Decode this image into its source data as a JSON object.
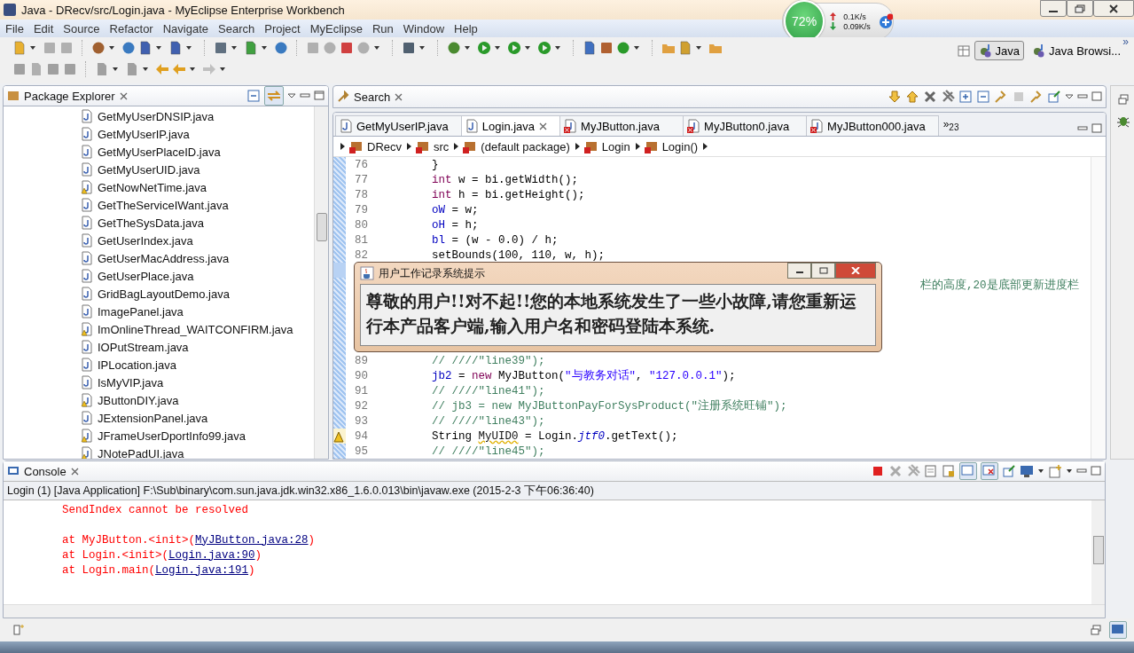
{
  "window": {
    "title": "Java - DRecv/src/Login.java - MyEclipse Enterprise Workbench"
  },
  "menu": [
    "File",
    "Edit",
    "Source",
    "Refactor",
    "Navigate",
    "Search",
    "Project",
    "MyEclipse",
    "Run",
    "Window",
    "Help"
  ],
  "network_widget": {
    "percent": "72%",
    "upload": "0.1K/s",
    "download": "0.09K/s"
  },
  "perspectives": [
    {
      "label": "Java",
      "selected": true
    },
    {
      "label": "Java Browsi...",
      "selected": false
    }
  ],
  "perspective_overflow": "»",
  "package_explorer": {
    "title": "Package Explorer",
    "items": [
      {
        "label": "GetMyUserDNSIP.java",
        "warning": false
      },
      {
        "label": "GetMyUserIP.java",
        "warning": false
      },
      {
        "label": "GetMyUserPlaceID.java",
        "warning": false
      },
      {
        "label": "GetMyUserUID.java",
        "warning": false
      },
      {
        "label": "GetNowNetTime.java",
        "warning": true
      },
      {
        "label": "GetTheServiceIWant.java",
        "warning": false
      },
      {
        "label": "GetTheSysData.java",
        "warning": false
      },
      {
        "label": "GetUserIndex.java",
        "warning": false
      },
      {
        "label": "GetUserMacAddress.java",
        "warning": false
      },
      {
        "label": "GetUserPlace.java",
        "warning": false
      },
      {
        "label": "GridBagLayoutDemo.java",
        "warning": false
      },
      {
        "label": "ImagePanel.java",
        "warning": false
      },
      {
        "label": "ImOnlineThread_WAITCONFIRM.java",
        "warning": true
      },
      {
        "label": "IOPutStream.java",
        "warning": false
      },
      {
        "label": "IPLocation.java",
        "warning": false
      },
      {
        "label": "IsMyVIP.java",
        "warning": false
      },
      {
        "label": "JButtonDIY.java",
        "warning": true
      },
      {
        "label": "JExtensionPanel.java",
        "warning": false
      },
      {
        "label": "JFrameUserDportInfo99.java",
        "warning": true
      },
      {
        "label": "JNotePadUI.java",
        "warning": true
      }
    ]
  },
  "search_view": {
    "title": "Search"
  },
  "editor": {
    "tabs": [
      {
        "label": "GetMyUserIP.java",
        "selected": false,
        "error": false
      },
      {
        "label": "Login.java",
        "selected": true,
        "error": false
      },
      {
        "label": "MyJButton.java",
        "selected": false,
        "error": true
      },
      {
        "label": "MyJButton0.java",
        "selected": false,
        "error": true
      },
      {
        "label": "MyJButton000.java",
        "selected": false,
        "error": true
      }
    ],
    "overflow": "»$_{23}$",
    "breadcrumb": [
      "DRecv",
      "src",
      "(default package)",
      "Login",
      "Login()"
    ],
    "lines": [
      {
        "number": "76",
        "covered": false,
        "marker": false,
        "segments": [
          {
            "t": "}",
            "kind": "plain"
          }
        ]
      },
      {
        "number": "77",
        "covered": false,
        "marker": false,
        "segments": [
          {
            "t": "int",
            "kind": "keyword"
          },
          {
            "t": " w = bi.getWidth();",
            "kind": "plain"
          }
        ]
      },
      {
        "number": "78",
        "covered": false,
        "marker": false,
        "segments": [
          {
            "t": "int",
            "kind": "keyword"
          },
          {
            "t": " h = bi.getHeight();",
            "kind": "plain"
          }
        ]
      },
      {
        "number": "79",
        "covered": false,
        "marker": false,
        "segments": [
          {
            "t": "oW",
            "kind": "field"
          },
          {
            "t": " = w;",
            "kind": "plain"
          }
        ]
      },
      {
        "number": "80",
        "covered": false,
        "marker": false,
        "segments": [
          {
            "t": "oH",
            "kind": "field"
          },
          {
            "t": " = h;",
            "kind": "plain"
          }
        ]
      },
      {
        "number": "81",
        "covered": false,
        "marker": false,
        "segments": [
          {
            "t": "bl",
            "kind": "field"
          },
          {
            "t": " = (w - 0.0) / h;",
            "kind": "plain"
          }
        ]
      },
      {
        "number": "82",
        "covered": false,
        "marker": false,
        "segments": [
          {
            "t": "setBounds(100, 110, w, h);",
            "kind": "plain"
          }
        ]
      },
      {
        "covered": true,
        "marker": false,
        "segments": [
          {
            "t": "栏的高度,20是底部更新进度栏",
            "kind": "comment"
          }
        ]
      },
      {
        "number": "89",
        "covered": false,
        "marker": false,
        "segments": [
          {
            "t": "// ////\"line39\");",
            "kind": "comment"
          }
        ]
      },
      {
        "number": "90",
        "covered": false,
        "marker": false,
        "segments": [
          {
            "t": "jb2",
            "kind": "field"
          },
          {
            "t": " = ",
            "kind": "plain"
          },
          {
            "t": "new",
            "kind": "keyword"
          },
          {
            "t": " MyJButton(",
            "kind": "plain"
          },
          {
            "t": "\"与教务对话\"",
            "kind": "string"
          },
          {
            "t": ", ",
            "kind": "plain"
          },
          {
            "t": "\"127.0.0.1\"",
            "kind": "string"
          },
          {
            "t": ");",
            "kind": "plain"
          }
        ]
      },
      {
        "number": "91",
        "covered": false,
        "marker": false,
        "segments": [
          {
            "t": "// ////\"line41\");",
            "kind": "comment"
          }
        ]
      },
      {
        "number": "92",
        "covered": false,
        "marker": false,
        "segments": [
          {
            "t": "// jb3 = new MyJButtonPayForSysProduct(\"注册系统旺铺\");",
            "kind": "comment"
          }
        ]
      },
      {
        "number": "93",
        "covered": false,
        "marker": false,
        "segments": [
          {
            "t": "// ////\"line43\");",
            "kind": "comment"
          }
        ]
      },
      {
        "number": "94",
        "covered": false,
        "marker": true,
        "segments": [
          {
            "t": "String ",
            "kind": "plain"
          },
          {
            "t": "MyUID0",
            "kind": "warning"
          },
          {
            "t": " = Login.",
            "kind": "plain"
          },
          {
            "t": "jtf0",
            "kind": "static"
          },
          {
            "t": ".getText();",
            "kind": "plain"
          }
        ]
      },
      {
        "number": "95",
        "covered": false,
        "marker": false,
        "segments": [
          {
            "t": "// ////\"line45\");",
            "kind": "comment"
          }
        ]
      }
    ]
  },
  "dialog": {
    "title": "用户工作记录系统提示",
    "message": "尊敬的用户!!对不起!!您的本地系统发生了一些小故障,请您重新运行本产品客户端,输入用户名和密码登陆本系统."
  },
  "console": {
    "title": "Console",
    "process": "Login (1) [Java Application] F:\\Sub\\binary\\com.sun.java.jdk.win32.x86_1.6.0.013\\bin\\javaw.exe (2015-2-3 下午06:36:40)",
    "output": [
      {
        "text": "SendIndex cannot be resolved"
      },
      {
        "text": "at MyJButton.<init>(",
        "link": "MyJButton.java:28",
        "end": ")"
      },
      {
        "text": "at Login.<init>(",
        "link": "Login.java:90",
        "end": ")"
      },
      {
        "text": "at Login.main(",
        "link": "Login.java:191",
        "end": ")"
      }
    ]
  }
}
